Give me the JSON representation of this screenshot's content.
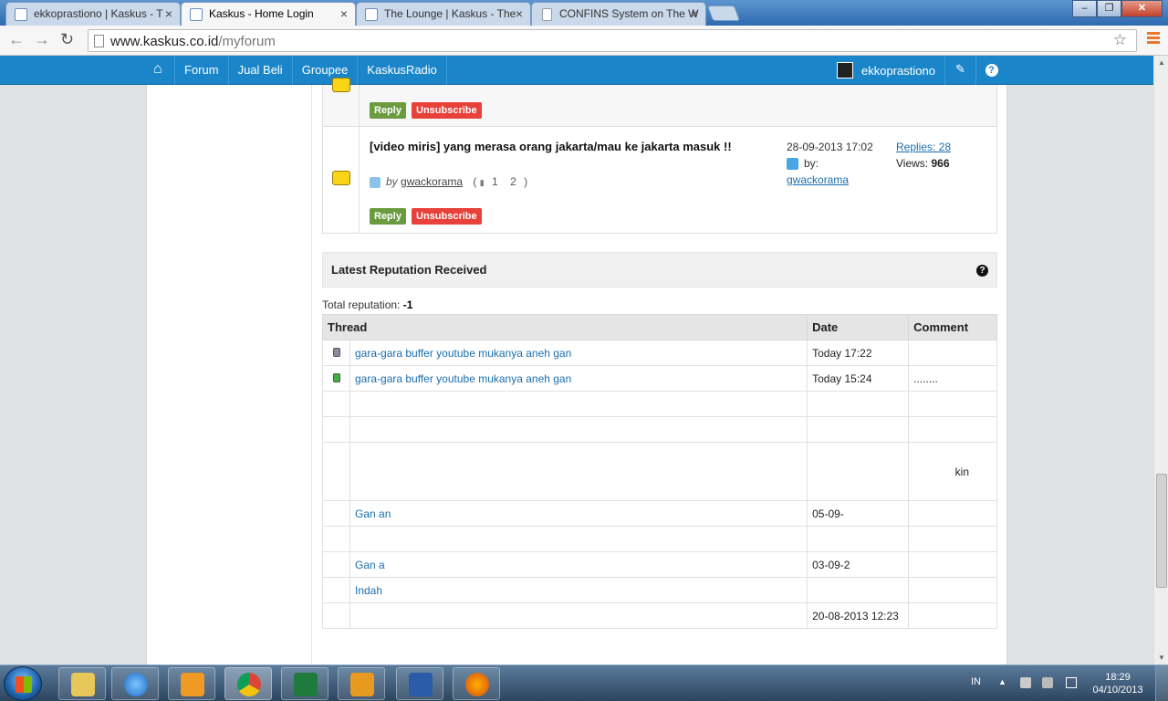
{
  "browser": {
    "tabs": [
      {
        "title": "ekkoprastiono | Kaskus - T",
        "active": false
      },
      {
        "title": "Kaskus - Home Login",
        "active": true
      },
      {
        "title": "The Lounge | Kaskus - The",
        "active": false
      },
      {
        "title": "CONFINS System on The W",
        "active": false
      }
    ],
    "url_host": "www.kaskus.co.id",
    "url_path": "/myforum"
  },
  "kaskus_nav": {
    "items": [
      "Forum",
      "Jual Beli",
      "Groupee",
      "KaskusRadio"
    ],
    "username": "ekkoprastiono",
    "help": "?"
  },
  "threads": [
    {
      "reply_label": "Reply",
      "unsubscribe_label": "Unsubscribe"
    },
    {
      "title": "[video miris] yang merasa orang jakarta/mau ke jakarta masuk !!",
      "by_label": "by",
      "author": "gwackorama",
      "pages_open": "(",
      "pages": [
        "1",
        "2"
      ],
      "pages_close": ")",
      "date": "28-09-2013 17:02",
      "last_by_label": "by:",
      "last_by": "gwackorama",
      "replies": "Replies: 28",
      "views_label": "Views:",
      "views": "966",
      "reply_label": "Reply",
      "unsubscribe_label": "Unsubscribe"
    }
  ],
  "reputation": {
    "heading": "Latest Reputation Received",
    "total_label": "Total reputation:",
    "total_value": "-1",
    "columns": [
      "Thread",
      "Date",
      "Comment"
    ],
    "rows": [
      {
        "thread": "gara-gara buffer youtube mukanya aneh gan",
        "date": "Today 17:22",
        "comment": "",
        "color": "grey"
      },
      {
        "thread": "gara-gara buffer youtube mukanya aneh gan",
        "date": "Today 15:24",
        "comment": "........",
        "color": "green"
      },
      {
        "thread": "",
        "date": "",
        "comment": ""
      },
      {
        "thread": "",
        "date": "",
        "comment": ""
      },
      {
        "thread": "",
        "date": "",
        "comment": "kin"
      },
      {
        "thread": "Gan an",
        "date": "05-09-",
        "comment": ""
      },
      {
        "thread": "",
        "date": "",
        "comment": ""
      },
      {
        "thread": "Gan a",
        "date": "03-09-2",
        "comment": ""
      },
      {
        "thread": "Indah",
        "date": "",
        "comment": ""
      },
      {
        "thread": "",
        "date": "20-08-2013 12:23",
        "comment": ""
      }
    ]
  },
  "taskbar": {
    "language": "IN",
    "time": "18:29",
    "date": "04/10/2013"
  },
  "colors": {
    "kaskus_blue": "#1a86c9",
    "reply_green": "#6a9b3e",
    "unsubscribe_red": "#e8403a"
  }
}
